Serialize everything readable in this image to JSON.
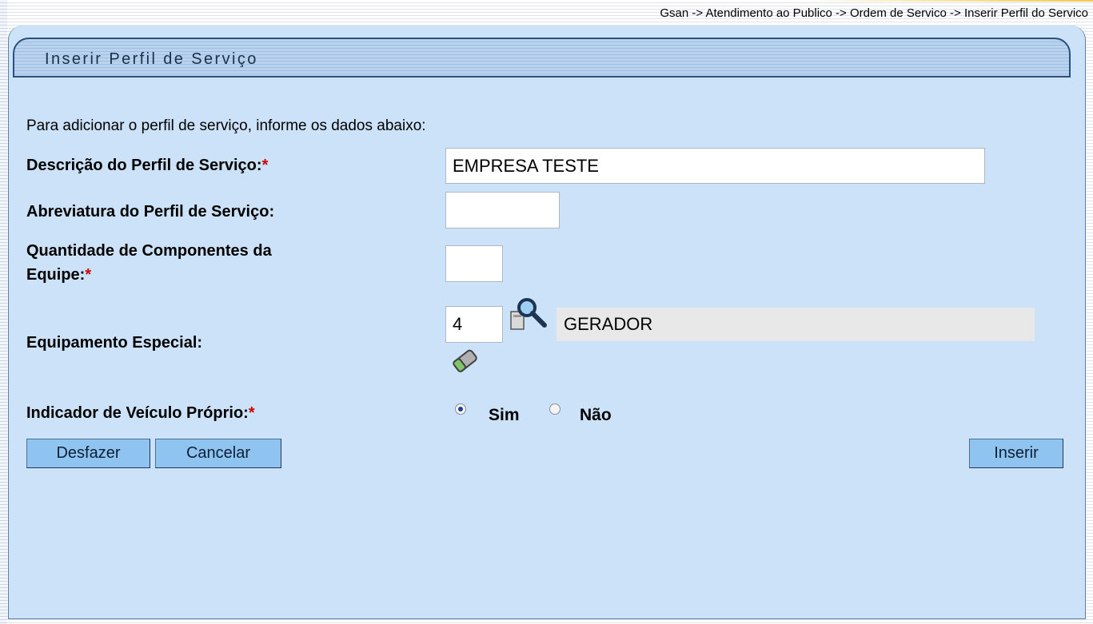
{
  "breadcrumb": "Gsan -> Atendimento ao Publico -> Ordem de Servico -> Inserir Perfil do Servico",
  "page_title": "Inserir Perfil de Serviço",
  "instruction": "Para adicionar o perfil de serviço, informe os dados abaixo:",
  "form": {
    "descricao_label": "Descrição do Perfil de Serviço:",
    "descricao_value": "EMPRESA TESTE",
    "abreviatura_label": "Abreviatura do Perfil de Serviço:",
    "abreviatura_value": "",
    "quantidade_label_line1": "Quantidade de Componentes da",
    "quantidade_label_line2": "Equipe:",
    "quantidade_value": "",
    "equipamento_label": "Equipamento Especial:",
    "equipamento_code": "4",
    "equipamento_name": "GERADOR",
    "veiculo_label": "Indicador de Veículo Próprio:",
    "veiculo_options": [
      "Sim",
      "Não"
    ],
    "veiculo_selected": "Sim",
    "required_mark": "*"
  },
  "buttons": {
    "desfazer": "Desfazer",
    "cancelar": "Cancelar",
    "inserir": "Inserir"
  },
  "icons": {
    "search": "magnifier-search-icon",
    "clear": "eraser-icon"
  },
  "colors": {
    "panel_background": "#cce2f8",
    "button_background": "#8fc4f0",
    "required": "#cc0000"
  }
}
